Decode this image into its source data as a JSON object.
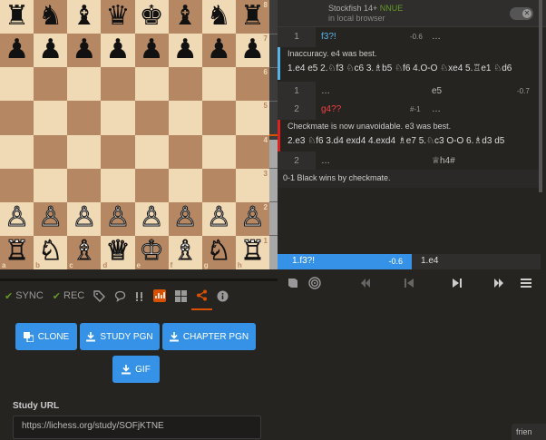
{
  "board": {
    "ranks": [
      "8",
      "7",
      "6",
      "5",
      "4",
      "3",
      "2",
      "1"
    ],
    "files": [
      "a",
      "b",
      "c",
      "d",
      "e",
      "f",
      "g",
      "h"
    ],
    "pieces": [
      [
        "♜",
        "♞",
        "♝",
        "♛",
        "♚",
        "♝",
        "♞",
        "♜"
      ],
      [
        "♟",
        "♟",
        "♟",
        "♟",
        "♟",
        "♟",
        "♟",
        "♟"
      ],
      [
        "",
        "",
        "",
        "",
        "",
        "",
        "",
        ""
      ],
      [
        "",
        "",
        "",
        "",
        "",
        "",
        "",
        ""
      ],
      [
        "",
        "",
        "",
        "",
        "",
        "",
        "",
        ""
      ],
      [
        "",
        "",
        "",
        "",
        "",
        "",
        "",
        ""
      ],
      [
        "♙",
        "♙",
        "♙",
        "♙",
        "♙",
        "♙",
        "♙",
        "♙"
      ],
      [
        "♖",
        "♘",
        "♗",
        "♕",
        "♔",
        "♗",
        "♘",
        "♖"
      ]
    ],
    "colors": [
      [
        "b",
        "b",
        "b",
        "b",
        "b",
        "b",
        "b",
        "b"
      ],
      [
        "b",
        "b",
        "b",
        "b",
        "b",
        "b",
        "b",
        "b"
      ],
      [
        "",
        "",
        "",
        "",
        "",
        "",
        "",
        ""
      ],
      [
        "",
        "",
        "",
        "",
        "",
        "",
        "",
        ""
      ],
      [
        "",
        "",
        "",
        "",
        "",
        "",
        "",
        ""
      ],
      [
        "",
        "",
        "",
        "",
        "",
        "",
        "",
        ""
      ],
      [
        "w",
        "w",
        "w",
        "w",
        "w",
        "w",
        "w",
        "w"
      ],
      [
        "w",
        "w",
        "w",
        "w",
        "w",
        "w",
        "w",
        "w"
      ]
    ]
  },
  "tool_tabs": {
    "sync": "SYNC",
    "rec": "REC"
  },
  "share": {
    "clone": "CLONE",
    "study_pgn": "STUDY PGN",
    "chapter_pgn": "CHAPTER PGN",
    "gif": "GIF",
    "study_url_label": "Study URL",
    "study_url": "https://lichess.org/study/SOFjKTNE"
  },
  "engine": {
    "name": "Stockfish 14+",
    "nnue": "NNUE",
    "sub": "in local browser"
  },
  "moves": {
    "row1": {
      "idx": "1",
      "white": "f3?!",
      "eval": "-0.6",
      "black": "…"
    },
    "comment1": {
      "text": "Inaccuracy. e4 was best.",
      "line": "1.e4 e5 2.♘f3 ♘c6 3.♗b5 ♘f6 4.O-O ♘xe4 5.♖e1 ♘d6"
    },
    "row1b": {
      "idx": "1",
      "white": "…",
      "black": "e5",
      "eval": "-0.7"
    },
    "row2": {
      "idx": "2",
      "white": "g4??",
      "eval": "#-1",
      "black": "…"
    },
    "comment2": {
      "text": "Checkmate is now unavoidable. e3 was best.",
      "line": "2.e3 ♘f6 3.d4 exd4 4.exd4 ♗e7 5.♘c3 O-O 6.♗d3 d5"
    },
    "row2b": {
      "idx": "2",
      "white": "…",
      "black": "♕h4#"
    },
    "result": "0-1 Black wins by checkmate."
  },
  "current": {
    "left": "1.f3?!",
    "left_eval": "-0.6",
    "right": "1.e4"
  },
  "friends": "frien"
}
